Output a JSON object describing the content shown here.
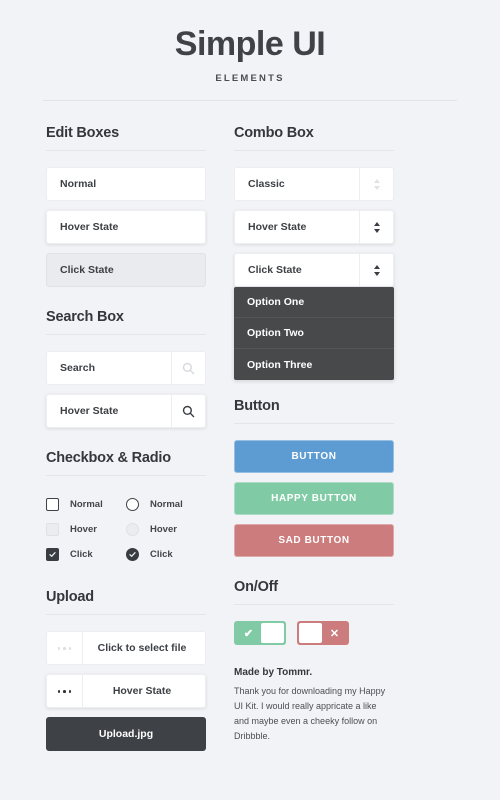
{
  "header": {
    "title": "Simple UI",
    "subtitle": "ELEMENTS"
  },
  "left_column": {
    "edit_boxes": {
      "title": "Edit Boxes",
      "fields": [
        {
          "label": "Normal",
          "state": "normal"
        },
        {
          "label": "Hover State",
          "state": "hover"
        },
        {
          "label": "Click State",
          "state": "click"
        }
      ]
    },
    "search_box": {
      "title": "Search Box",
      "fields": [
        {
          "label": "Search",
          "state": "normal",
          "icon": "search-icon"
        },
        {
          "label": "Hover State",
          "state": "hover",
          "icon": "search-icon"
        }
      ]
    },
    "checkbox_radio": {
      "title": "Checkbox & Radio",
      "checkboxes": [
        {
          "label": "Normal",
          "state": "normal",
          "checked": false
        },
        {
          "label": "Hover",
          "state": "hover",
          "checked": false
        },
        {
          "label": "Click",
          "state": "click",
          "checked": true
        }
      ],
      "radios": [
        {
          "label": "Normal",
          "state": "normal",
          "checked": false
        },
        {
          "label": "Hover",
          "state": "hover",
          "checked": false
        },
        {
          "label": "Click",
          "state": "click",
          "checked": true
        }
      ]
    },
    "upload": {
      "title": "Upload",
      "fields": [
        {
          "label": "Click to select file",
          "state": "normal",
          "icon": "ellipsis-icon"
        },
        {
          "label": "Hover State",
          "state": "hover",
          "icon": "ellipsis-icon"
        },
        {
          "label": "Upload.jpg",
          "state": "filled"
        }
      ]
    }
  },
  "right_column": {
    "combo_box": {
      "title": "Combo Box",
      "fields": [
        {
          "label": "Classic",
          "state": "normal",
          "icon": "chevron-updown-icon"
        },
        {
          "label": "Hover State",
          "state": "hover",
          "icon": "chevron-updown-icon"
        },
        {
          "label": "Click State",
          "state": "click-open",
          "icon": "chevron-updown-icon"
        }
      ],
      "options": [
        "Option One",
        "Option Two",
        "Option Three"
      ]
    },
    "button": {
      "title": "Button",
      "buttons": [
        {
          "label": "BUTTON",
          "color": "#5c9cd2"
        },
        {
          "label": "HAPPY BUTTON",
          "color": "#80cba5"
        },
        {
          "label": "SAD BUTTON",
          "color": "#cc7c7c"
        }
      ]
    },
    "onoff": {
      "title": "On/Off",
      "toggles": [
        {
          "state": "on",
          "color": "#80cba5",
          "mark": "✔"
        },
        {
          "state": "off",
          "color": "#cc7c7c",
          "mark": "✕"
        }
      ]
    },
    "footer": {
      "title": "Made by Tommr.",
      "text": "Thank you for downloading my Happy UI Kit. I would really appricate a like and maybe even a cheeky follow on Dribbble."
    }
  },
  "colors": {
    "background": "#f2f3f6",
    "surface": "#ffffff",
    "text": "#3c3f43",
    "dark": "#3e4145",
    "dropdown_bg": "#48494b",
    "blue": "#5c9cd2",
    "green": "#80cba5",
    "red": "#cc7c7c"
  }
}
